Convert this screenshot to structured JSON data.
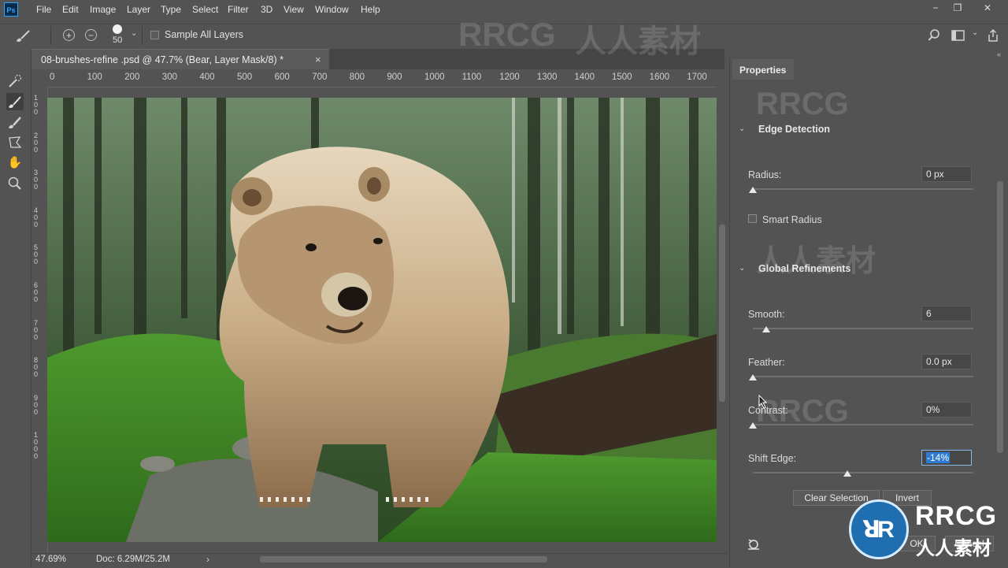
{
  "menu": {
    "logo": "Ps",
    "items": [
      "File",
      "Edit",
      "Image",
      "Layer",
      "Type",
      "Select",
      "Filter",
      "3D",
      "View",
      "Window",
      "Help"
    ]
  },
  "window_controls": {
    "minimize": "−",
    "restore": "❐",
    "close": "✕"
  },
  "options_bar": {
    "brush_size": "50",
    "sample_all_layers_label": "Sample All Layers",
    "sample_all_layers_checked": false
  },
  "document": {
    "tab_title": "08-brushes-refine .psd @ 47.7% (Bear, Layer Mask/8) *",
    "close": "×"
  },
  "ruler": {
    "h_ticks": [
      "0",
      "100",
      "200",
      "300",
      "400",
      "500",
      "600",
      "700",
      "800",
      "900",
      "1000",
      "1100",
      "1200",
      "1300",
      "1400",
      "1500",
      "1600",
      "1700"
    ],
    "v_ticks": [
      "1\n0\n0",
      "2\n0\n0",
      "3\n0\n0",
      "4\n0\n0",
      "5\n0\n0",
      "6\n0\n0",
      "7\n0\n0",
      "8\n0\n0",
      "9\n0\n0",
      "1\n0\n0\n0"
    ]
  },
  "status": {
    "zoom": "47.69%",
    "doc": "Doc: 6.29M/25.2M",
    "arrow": "›"
  },
  "properties": {
    "tab_label": "Properties",
    "edge_detection": {
      "title": "Edge Detection",
      "radius_label": "Radius:",
      "radius_value": "0 px",
      "radius_level": 0,
      "smart_radius_label": "Smart Radius",
      "smart_radius_checked": false
    },
    "global_refinements": {
      "title": "Global Refinements",
      "smooth_label": "Smooth:",
      "smooth_value": "6",
      "smooth_level": 0.06,
      "feather_label": "Feather:",
      "feather_value": "0.0 px",
      "feather_level": 0,
      "contrast_label": "Contrast:",
      "contrast_value": "0%",
      "contrast_level": 0,
      "shift_label": "Shift Edge:",
      "shift_value": "-14%",
      "shift_level": 0.43
    },
    "clear_selection_label": "Clear Selection",
    "invert_label": "Invert",
    "ok_label": "OK",
    "cancel_label": "Cancel"
  },
  "watermark": {
    "text1": "RRCG",
    "text2": "人人素材"
  },
  "icons": [
    "ps-logo",
    "brush-icon",
    "add-to-selection-icon",
    "subtract-from-selection-icon",
    "search-icon",
    "workspace-icon",
    "share-icon",
    "quick-selection-icon",
    "refine-edge-brush-icon",
    "brush-tool-icon",
    "lasso-icon",
    "hand-icon",
    "zoom-icon",
    "reset-icon",
    "collapse-chevron-icon"
  ],
  "colors": {
    "accent": "#31a8ff",
    "ui_bg": "#535353",
    "field_bg": "#474747",
    "selected_text_bg": "#2d7bd3"
  }
}
